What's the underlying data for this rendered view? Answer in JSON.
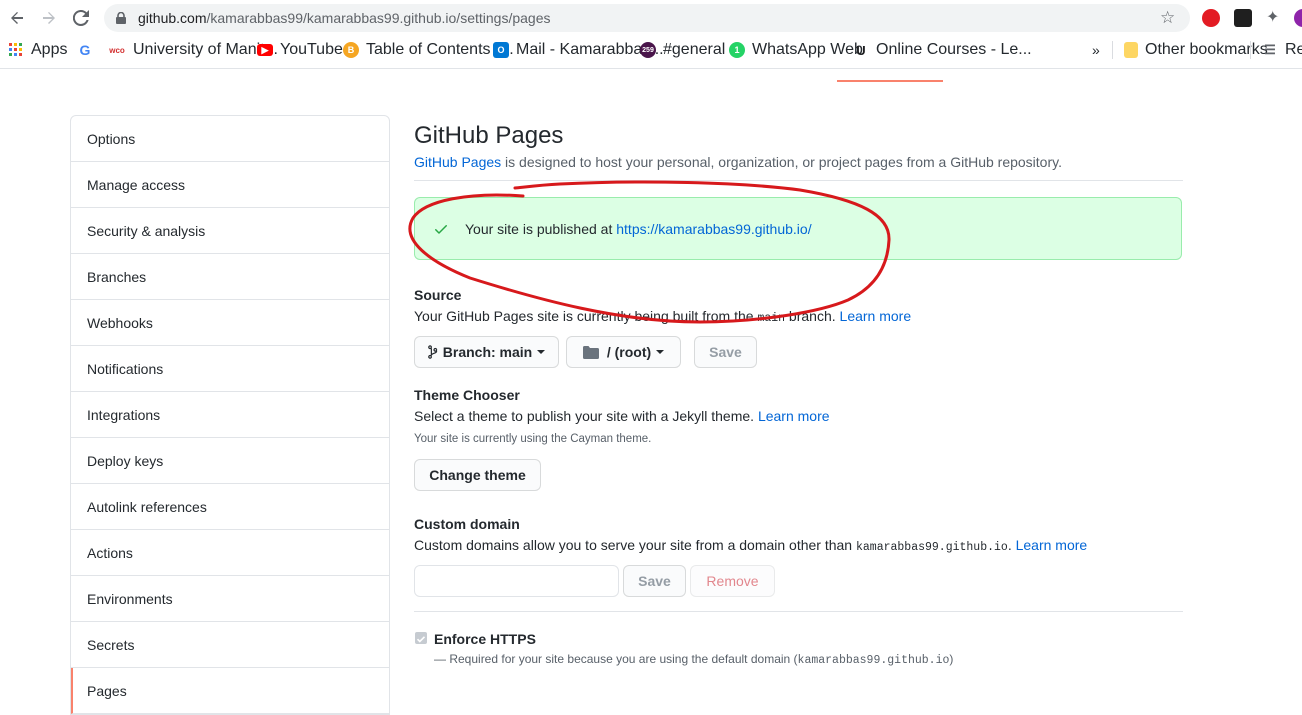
{
  "browser": {
    "url_host": "github.com",
    "url_path": "/kamarabbas99/kamarabbas99.github.io/settings/pages",
    "bookmarks": [
      {
        "label": "Apps",
        "icon": "apps-grid-icon"
      },
      {
        "label": "",
        "icon": "google-icon"
      },
      {
        "label": "University of Manit...",
        "icon": "wco-icon",
        "badge": "wco"
      },
      {
        "label": "YouTube",
        "icon": "youtube-icon"
      },
      {
        "label": "Table of Contents -...",
        "icon": "book-icon"
      },
      {
        "label": "Mail - Kamarabbas...",
        "icon": "outlook-icon"
      },
      {
        "label": "#general",
        "icon": "slack-icon",
        "badge": "259"
      },
      {
        "label": "WhatsApp Web",
        "icon": "whatsapp-icon",
        "badge": "1"
      },
      {
        "label": "Online Courses - Le...",
        "icon": "udemy-icon"
      }
    ],
    "more_chevron": "»",
    "other_bookmarks": "Other bookmarks",
    "reading_list": "Rea"
  },
  "sidebar": {
    "items": [
      {
        "label": "Options"
      },
      {
        "label": "Manage access"
      },
      {
        "label": "Security & analysis"
      },
      {
        "label": "Branches"
      },
      {
        "label": "Webhooks"
      },
      {
        "label": "Notifications"
      },
      {
        "label": "Integrations"
      },
      {
        "label": "Deploy keys"
      },
      {
        "label": "Autolink references"
      },
      {
        "label": "Actions"
      },
      {
        "label": "Environments"
      },
      {
        "label": "Secrets"
      },
      {
        "label": "Pages"
      }
    ]
  },
  "pages": {
    "title": "GitHub Pages",
    "subhead_link": "GitHub Pages",
    "subhead_rest": " is designed to host your personal, organization, or project pages from a GitHub repository.",
    "flash_text": "Your site is published at ",
    "flash_link": "https://kamarabbas99.github.io/",
    "source": {
      "title": "Source",
      "text_before": "Your GitHub Pages site is currently being built from the ",
      "branch_code": "main",
      "text_after": " branch. ",
      "learn_more": "Learn more",
      "branch_button": "Branch: main",
      "folder_button": "/ (root)",
      "save_button": "Save"
    },
    "theme": {
      "title": "Theme Chooser",
      "text": "Select a theme to publish your site with a Jekyll theme. ",
      "learn_more": "Learn more",
      "note_before": "Your site is currently using the ",
      "theme_name": "Cayman",
      "note_after": " theme.",
      "change_button": "Change theme"
    },
    "custom_domain": {
      "title": "Custom domain",
      "text_before": "Custom domains allow you to serve your site from a domain other than ",
      "domain_code": "kamarabbas99.github.io",
      "text_after": ". ",
      "learn_more": "Learn more",
      "input_value": "",
      "save_button": "Save",
      "remove_button": "Remove"
    },
    "https": {
      "label": "Enforce HTTPS",
      "note_before": "— Required for your site because you are using the default domain (",
      "note_code": "kamarabbas99.github.io",
      "note_after": ")"
    }
  },
  "colors": {
    "link": "#0366d6",
    "flash_bg": "#dcffe4",
    "annotation": "#d7191c",
    "selected_tab": "#f9826c"
  }
}
